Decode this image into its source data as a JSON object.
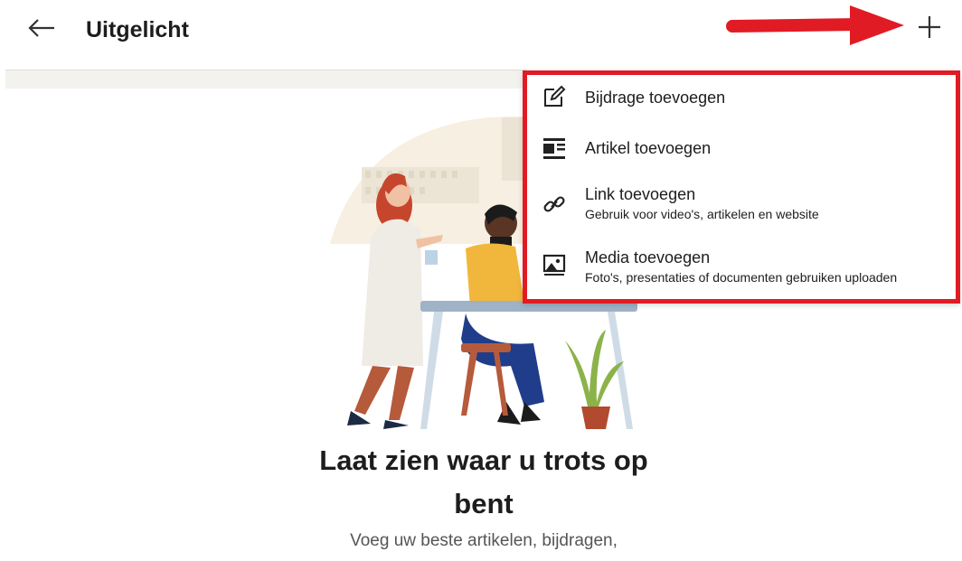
{
  "header": {
    "title": "Uitgelicht",
    "back_icon": "arrow-left-icon",
    "add_icon": "plus-icon"
  },
  "annotation": {
    "arrow_color": "#e11b24"
  },
  "menu": {
    "border_color": "#e11b24",
    "items": [
      {
        "label": "Bijdrage toevoegen",
        "description": "",
        "icon": "edit-pencil-icon"
      },
      {
        "label": "Artikel toevoegen",
        "description": "",
        "icon": "article-icon"
      },
      {
        "label": "Link toevoegen",
        "description": "Gebruik voor video's, artikelen en website",
        "icon": "link-icon"
      },
      {
        "label": "Media toevoegen",
        "description": "Foto's, presentaties of documenten gebruiken uploaden",
        "icon": "image-icon"
      }
    ]
  },
  "empty_state": {
    "headline_line1": "Laat zien waar u trots op",
    "headline_line2": "bent",
    "subtext_line1": "Voeg uw beste artikelen, bijdragen,"
  }
}
